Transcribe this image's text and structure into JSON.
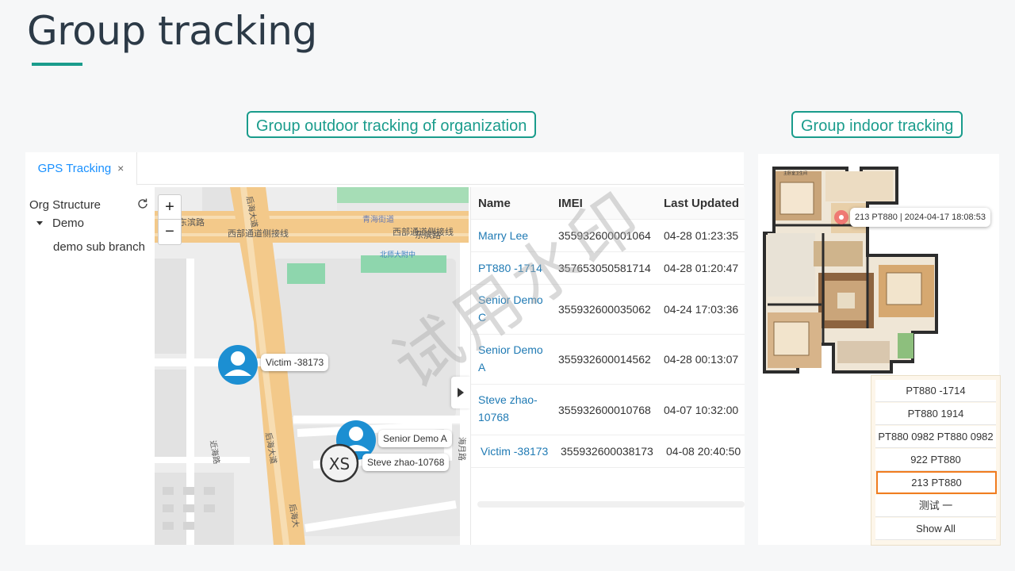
{
  "slide": {
    "title": "Group tracking",
    "outdoor_callout": "Group outdoor tracking of organization",
    "indoor_callout": "Group indoor tracking",
    "watermark": "试用水印"
  },
  "tab": {
    "label": "GPS Tracking",
    "close": "×"
  },
  "org": {
    "header": "Org Structure",
    "root": "Demo",
    "child": "demo sub branch"
  },
  "map": {
    "zoom_in": "+",
    "zoom_out": "−",
    "streets": [
      "东滨路",
      "西部通道侧接线",
      "青海街道",
      "西部通道侧接线",
      "东滨路",
      "北师大附中",
      "后海大道",
      "近海路",
      "后海大道",
      "海月路",
      "后海大"
    ],
    "markers": [
      {
        "label": "Victim -38173"
      },
      {
        "label": "Senior Demo A"
      },
      {
        "label": "Steve zhao-10768",
        "avatar_text": "XS"
      }
    ]
  },
  "table": {
    "headers": [
      "Name",
      "IMEI",
      "Last Updated"
    ],
    "rows": [
      {
        "name": "Marry Lee",
        "imei": "355932600001064",
        "time": "04-28 01:23:35"
      },
      {
        "name": "PT880 -1714",
        "imei": "357653050581714",
        "time": "04-28 01:20:47"
      },
      {
        "name": "Senior Demo C",
        "imei": "355932600035062",
        "time": "04-24 17:03:36"
      },
      {
        "name": "Senior Demo A",
        "imei": "355932600014562",
        "time": "04-28 00:13:07"
      },
      {
        "name": "Steve zhao-10768",
        "imei": "355932600010768",
        "time": "04-07 10:32:00"
      },
      {
        "name": "Victim -38173",
        "imei": "355932600038173",
        "time": "04-08 20:40:50"
      }
    ]
  },
  "indoor": {
    "marker_label": "213 PT880 | 2024-04-17 18:08:53",
    "room_label": "主卧室卫生间",
    "devices": [
      "PT880 -1714",
      "PT880 1914",
      "PT880 0982 PT880 0982",
      "922 PT880",
      "213 PT880",
      "测试 一",
      "Show All"
    ],
    "selected_device": "213 PT880"
  },
  "colors": {
    "accent": "#1a9c8c",
    "link": "#1f7ab4",
    "tab_active": "#1890ff",
    "marker_blue": "#1c8fd2",
    "selected_border": "#f07c1f"
  }
}
